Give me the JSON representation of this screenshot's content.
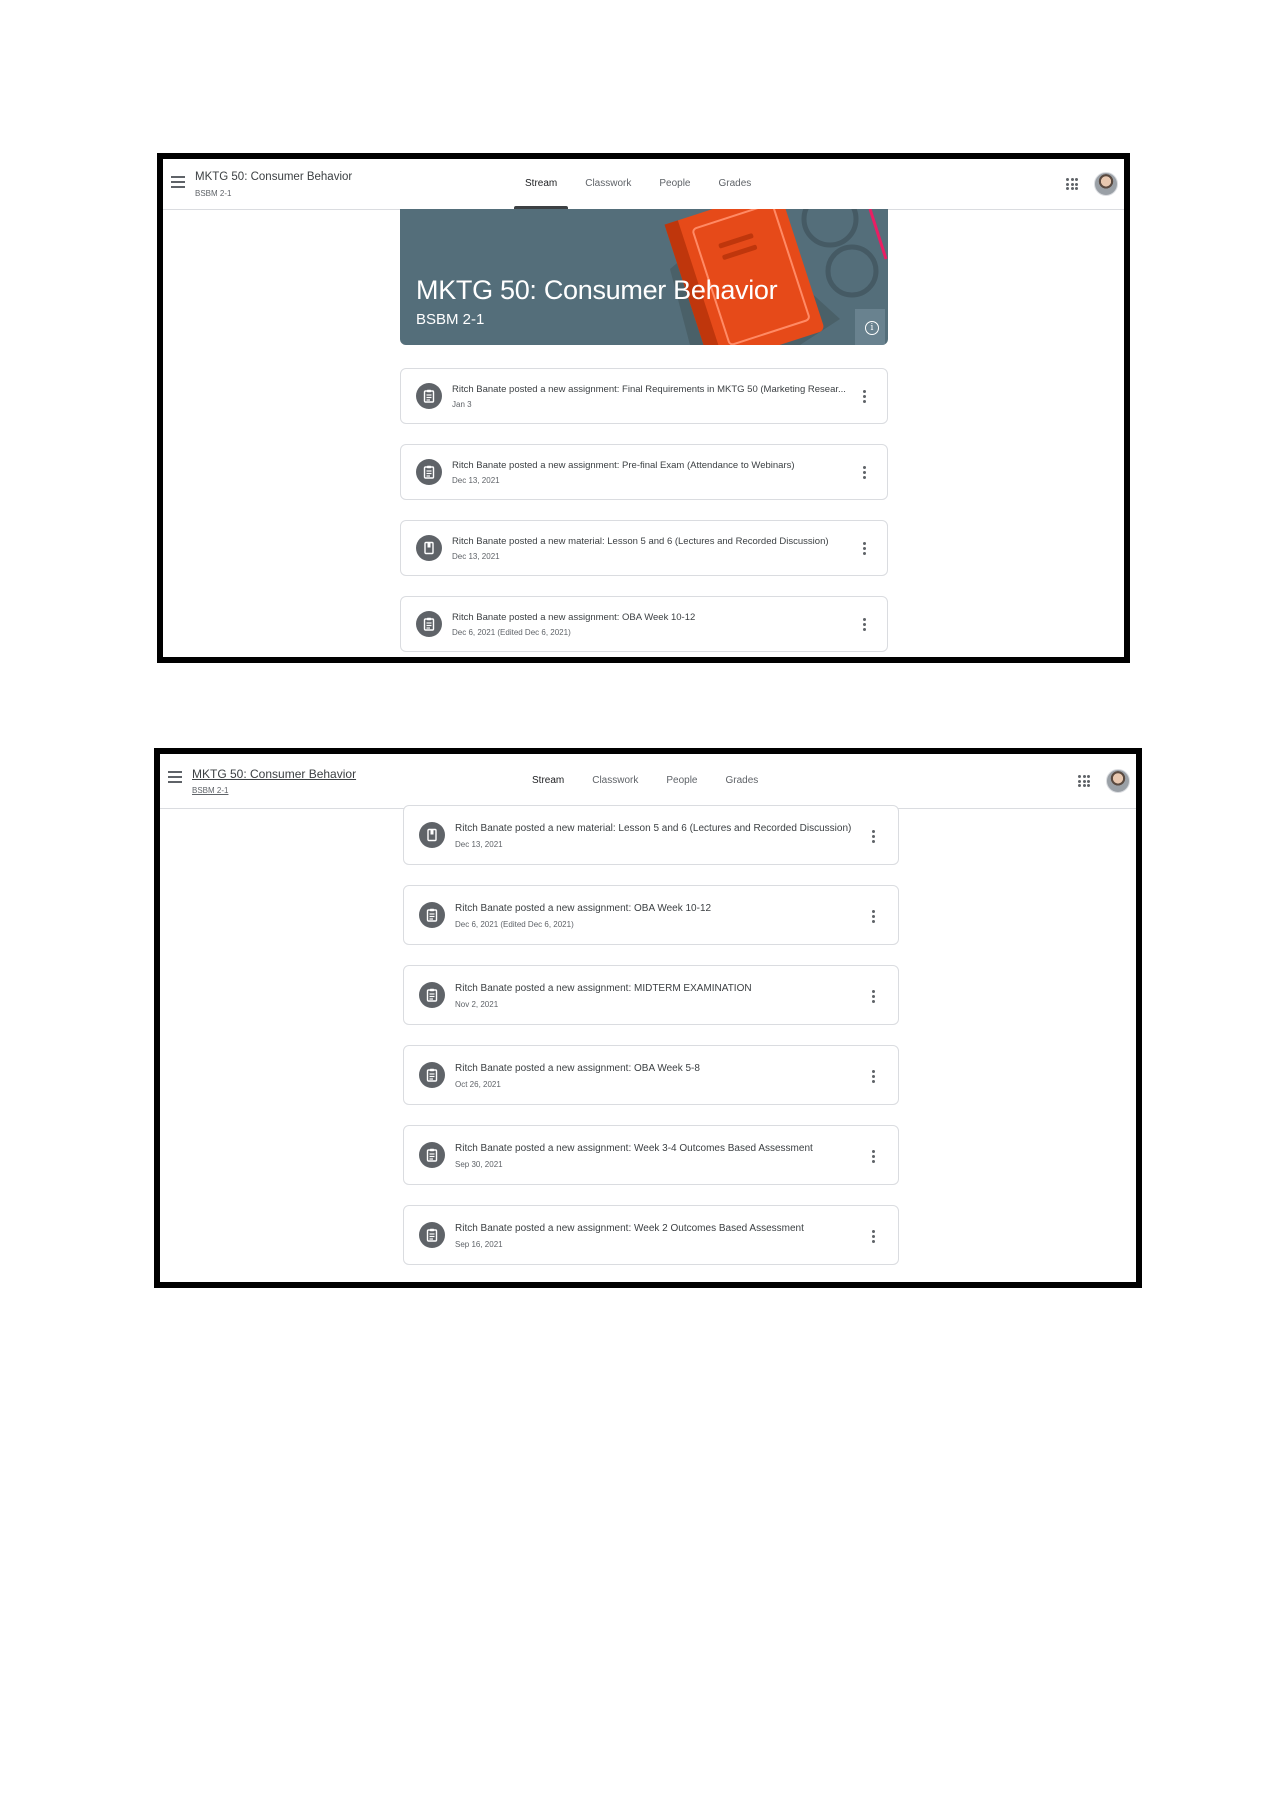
{
  "screen1": {
    "header": {
      "course_title": "MKTG 50: Consumer Behavior",
      "course_section": "BSBM 2-1"
    },
    "tabs": [
      {
        "label": "Stream",
        "active": true
      },
      {
        "label": "Classwork",
        "active": false
      },
      {
        "label": "People",
        "active": false
      },
      {
        "label": "Grades",
        "active": false
      }
    ],
    "banner": {
      "title": "MKTG 50: Consumer Behavior",
      "subtitle": "BSBM 2-1",
      "color": "#546e7a"
    },
    "posts": [
      {
        "type": "assignment",
        "icon": "assignment-icon",
        "text": "Ritch Banate posted a new assignment: Final Requirements in MKTG 50 (Marketing Resear...",
        "date": "Jan 3"
      },
      {
        "type": "assignment",
        "icon": "assignment-icon",
        "text": "Ritch Banate posted a new assignment: Pre-final Exam (Attendance to Webinars)",
        "date": "Dec 13, 2021"
      },
      {
        "type": "material",
        "icon": "material-icon",
        "text": "Ritch Banate posted a new material: Lesson 5 and 6 (Lectures and Recorded Discussion)",
        "date": "Dec 13, 2021"
      },
      {
        "type": "assignment",
        "icon": "assignment-icon",
        "text": "Ritch Banate posted a new assignment: OBA Week 10-12",
        "date": "Dec 6, 2021 (Edited Dec 6, 2021)"
      }
    ]
  },
  "screen2": {
    "header": {
      "course_title": "MKTG 50: Consumer Behavior",
      "course_section": "BSBM 2-1"
    },
    "tabs": [
      {
        "label": "Stream",
        "active": true
      },
      {
        "label": "Classwork",
        "active": false
      },
      {
        "label": "People",
        "active": false
      },
      {
        "label": "Grades",
        "active": false
      }
    ],
    "posts": [
      {
        "type": "material",
        "icon": "material-icon",
        "text": "Ritch Banate posted a new material: Lesson 5 and 6 (Lectures and Recorded Discussion)",
        "date": "Dec 13, 2021"
      },
      {
        "type": "assignment",
        "icon": "assignment-icon",
        "text": "Ritch Banate posted a new assignment: OBA Week 10-12",
        "date": "Dec 6, 2021 (Edited Dec 6, 2021)"
      },
      {
        "type": "assignment",
        "icon": "assignment-icon",
        "text": "Ritch Banate posted a new assignment: MIDTERM EXAMINATION",
        "date": "Nov 2, 2021"
      },
      {
        "type": "assignment",
        "icon": "assignment-icon",
        "text": "Ritch Banate posted a new assignment: OBA Week 5-8",
        "date": "Oct 26, 2021"
      },
      {
        "type": "assignment",
        "icon": "assignment-icon",
        "text": "Ritch Banate posted a new assignment: Week 3-4 Outcomes Based Assessment",
        "date": "Sep 30, 2021"
      },
      {
        "type": "assignment",
        "icon": "assignment-icon",
        "text": "Ritch Banate posted a new assignment: Week 2 Outcomes Based Assessment",
        "date": "Sep 16, 2021"
      }
    ]
  }
}
